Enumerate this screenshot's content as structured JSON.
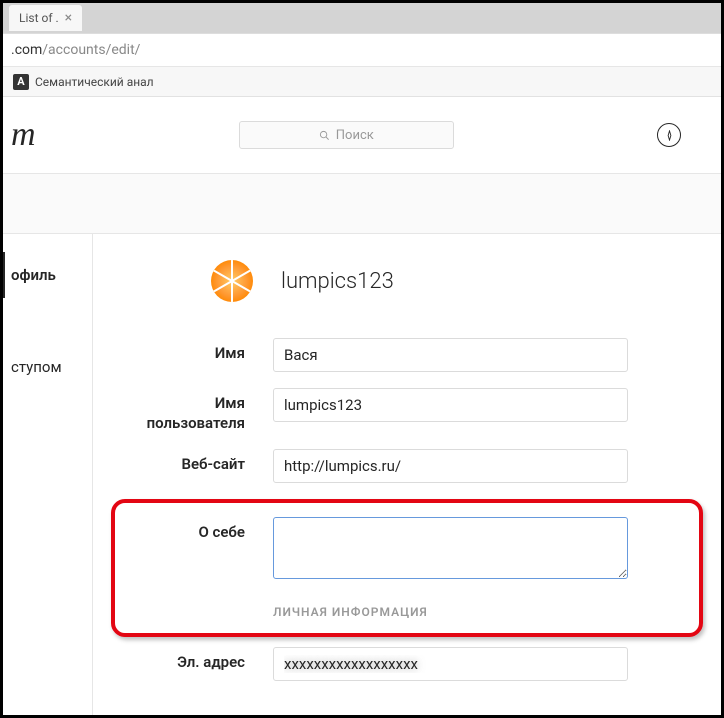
{
  "browser": {
    "tab_title": "List of .",
    "url_host": ".com",
    "url_path": "/accounts/edit/",
    "bookmark1": "Семантический анал"
  },
  "header": {
    "logo_fragment": "m",
    "search_placeholder": "Поиск"
  },
  "sidebar": {
    "items": [
      {
        "label": "офиль"
      },
      {
        "label": "ступом"
      }
    ]
  },
  "profile": {
    "username_display": "lumpics123",
    "fields": {
      "name_label": "Имя",
      "name_value": "Вася",
      "username_label": "Имя пользователя",
      "username_value": "lumpics123",
      "website_label": "Веб-сайт",
      "website_value": "http://lumpics.ru/",
      "bio_label": "О себе",
      "bio_value": "",
      "section_heading": "ЛИЧНАЯ ИНФОРМАЦИЯ",
      "email_label": "Эл. адрес",
      "email_value": "xxxxxxxxxxxxxxxxxx"
    }
  }
}
